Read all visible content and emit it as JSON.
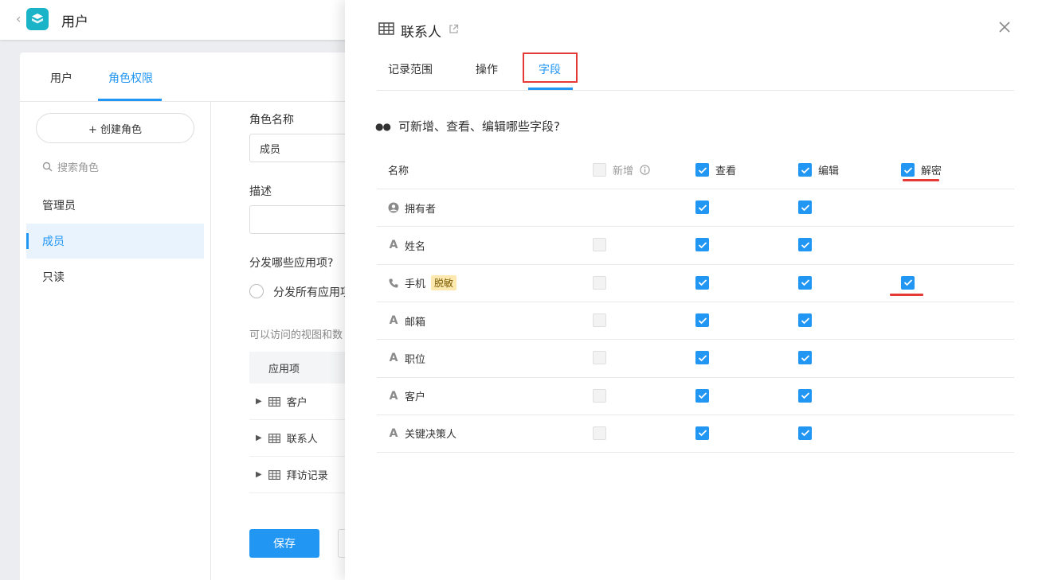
{
  "header": {
    "app_title": "用户"
  },
  "main_tabs": [
    {
      "label": "用户"
    },
    {
      "label": "角色权限"
    }
  ],
  "roles": {
    "create_label": "+ 创建角色",
    "search_placeholder": "搜索角色",
    "items": [
      {
        "label": "管理员"
      },
      {
        "label": "成员"
      },
      {
        "label": "只读"
      }
    ]
  },
  "form": {
    "role_name_label": "角色名称",
    "role_name_value": "成员",
    "desc_label": "描述",
    "distribute_label": "分发哪些应用项?",
    "distribute_all": "分发所有应用项",
    "access_hint": "可以访问的视图和数",
    "apps_header": "应用项",
    "apps": [
      {
        "label": "客户"
      },
      {
        "label": "联系人"
      },
      {
        "label": "拜访记录"
      }
    ],
    "save_label": "保存"
  },
  "drawer": {
    "title": "联系人",
    "tabs": [
      {
        "label": "记录范围"
      },
      {
        "label": "操作"
      },
      {
        "label": "字段"
      }
    ],
    "question": "可新增、查看、编辑哪些字段?",
    "columns": {
      "name": "名称",
      "add": "新增",
      "view": "查看",
      "edit": "编辑",
      "decrypt": "解密"
    },
    "fields": [
      {
        "name": "拥有者",
        "badge": "",
        "icon": "user-circle-icon",
        "add": null,
        "view": true,
        "edit": true,
        "decrypt": null
      },
      {
        "name": "姓名",
        "badge": "",
        "icon": "text-field-icon",
        "add": false,
        "view": true,
        "edit": true,
        "decrypt": null
      },
      {
        "name": "手机",
        "badge": "脱敏",
        "icon": "phone-icon",
        "add": false,
        "view": true,
        "edit": true,
        "decrypt": true
      },
      {
        "name": "邮箱",
        "badge": "",
        "icon": "text-field-icon",
        "add": false,
        "view": true,
        "edit": true,
        "decrypt": null
      },
      {
        "name": "职位",
        "badge": "",
        "icon": "text-field-icon",
        "add": false,
        "view": true,
        "edit": true,
        "decrypt": null
      },
      {
        "name": "客户",
        "badge": "",
        "icon": "text-field-icon",
        "add": false,
        "view": true,
        "edit": true,
        "decrypt": null
      },
      {
        "name": "关键决策人",
        "badge": "",
        "icon": "text-field-icon",
        "add": false,
        "view": true,
        "edit": true,
        "decrypt": null
      }
    ]
  },
  "colors": {
    "accent": "#2196f3",
    "highlight_red": "#e53935",
    "badge_bg": "#fde9b0"
  }
}
